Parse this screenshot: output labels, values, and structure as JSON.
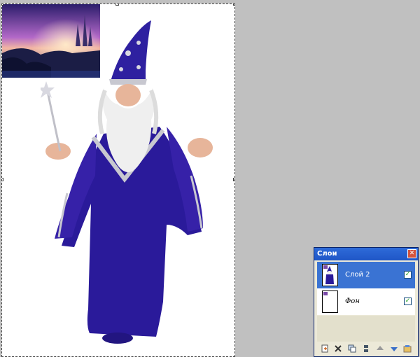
{
  "layers_panel": {
    "title": "Слои",
    "close_icon": "close-icon",
    "layers": [
      {
        "name": "Слой 2",
        "visible": true,
        "selected": true
      },
      {
        "name": "Фон",
        "visible": true,
        "selected": false
      }
    ],
    "toolbar_icons": [
      "new-layer-icon",
      "delete-layer-icon",
      "duplicate-layer-icon",
      "merge-layer-icon",
      "move-layer-up-icon",
      "move-layer-down-icon",
      "layer-properties-icon"
    ]
  },
  "colors": {
    "canvas_bg": "#ffffff",
    "workspace_bg": "#c0c0c0",
    "panel_title": "#2e6bd9",
    "selected_row": "#3a73d3",
    "robe": "#2a1a9a"
  }
}
